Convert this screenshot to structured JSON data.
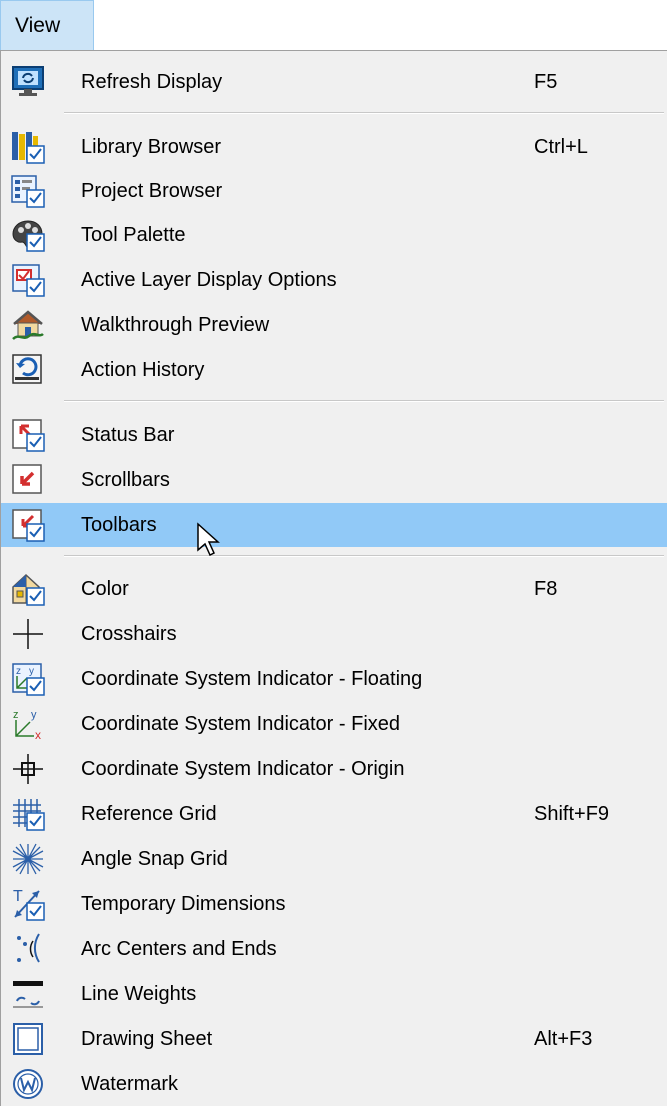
{
  "menubar": {
    "view_label": "View"
  },
  "menu": {
    "items": [
      {
        "label": "Refresh Display",
        "shortcut": "F5",
        "icon": "refresh-display-icon"
      },
      {
        "label": "Library Browser",
        "shortcut": "Ctrl+L",
        "icon": "library-browser-icon"
      },
      {
        "label": "Project Browser",
        "shortcut": "",
        "icon": "project-browser-icon"
      },
      {
        "label": "Tool Palette",
        "shortcut": "",
        "icon": "tool-palette-icon"
      },
      {
        "label": "Active Layer Display Options",
        "shortcut": "",
        "icon": "layer-display-icon"
      },
      {
        "label": "Walkthrough Preview",
        "shortcut": "",
        "icon": "walkthrough-preview-icon"
      },
      {
        "label": "Action History",
        "shortcut": "",
        "icon": "action-history-icon"
      },
      {
        "label": "Status Bar",
        "shortcut": "",
        "icon": "status-bar-icon"
      },
      {
        "label": "Scrollbars",
        "shortcut": "",
        "icon": "scrollbars-icon"
      },
      {
        "label": "Toolbars",
        "shortcut": "",
        "icon": "toolbars-icon"
      },
      {
        "label": "Color",
        "shortcut": "F8",
        "icon": "color-icon"
      },
      {
        "label": "Crosshairs",
        "shortcut": "",
        "icon": "crosshairs-icon"
      },
      {
        "label": "Coordinate System Indicator - Floating",
        "shortcut": "",
        "icon": "coordinate-floating-icon"
      },
      {
        "label": "Coordinate System Indicator - Fixed",
        "shortcut": "",
        "icon": "coordinate-fixed-icon"
      },
      {
        "label": "Coordinate System Indicator - Origin",
        "shortcut": "",
        "icon": "coordinate-origin-icon"
      },
      {
        "label": "Reference Grid",
        "shortcut": "Shift+F9",
        "icon": "reference-grid-icon"
      },
      {
        "label": "Angle Snap Grid",
        "shortcut": "",
        "icon": "angle-snap-grid-icon"
      },
      {
        "label": "Temporary Dimensions",
        "shortcut": "",
        "icon": "temporary-dimensions-icon"
      },
      {
        "label": "Arc Centers and Ends",
        "shortcut": "",
        "icon": "arc-centers-icon"
      },
      {
        "label": "Line Weights",
        "shortcut": "",
        "icon": "line-weights-icon"
      },
      {
        "label": "Drawing Sheet",
        "shortcut": "Alt+F3",
        "icon": "drawing-sheet-icon"
      },
      {
        "label": "Watermark",
        "shortcut": "",
        "icon": "watermark-icon"
      }
    ],
    "highlighted_item": "Toolbars"
  },
  "colors": {
    "menu_bg": "#f0f0f0",
    "highlight": "#91c9f7",
    "menubar_active": "#cce4f7",
    "check_blue": "#1a5fb4",
    "accent_red": "#d32f2f"
  }
}
